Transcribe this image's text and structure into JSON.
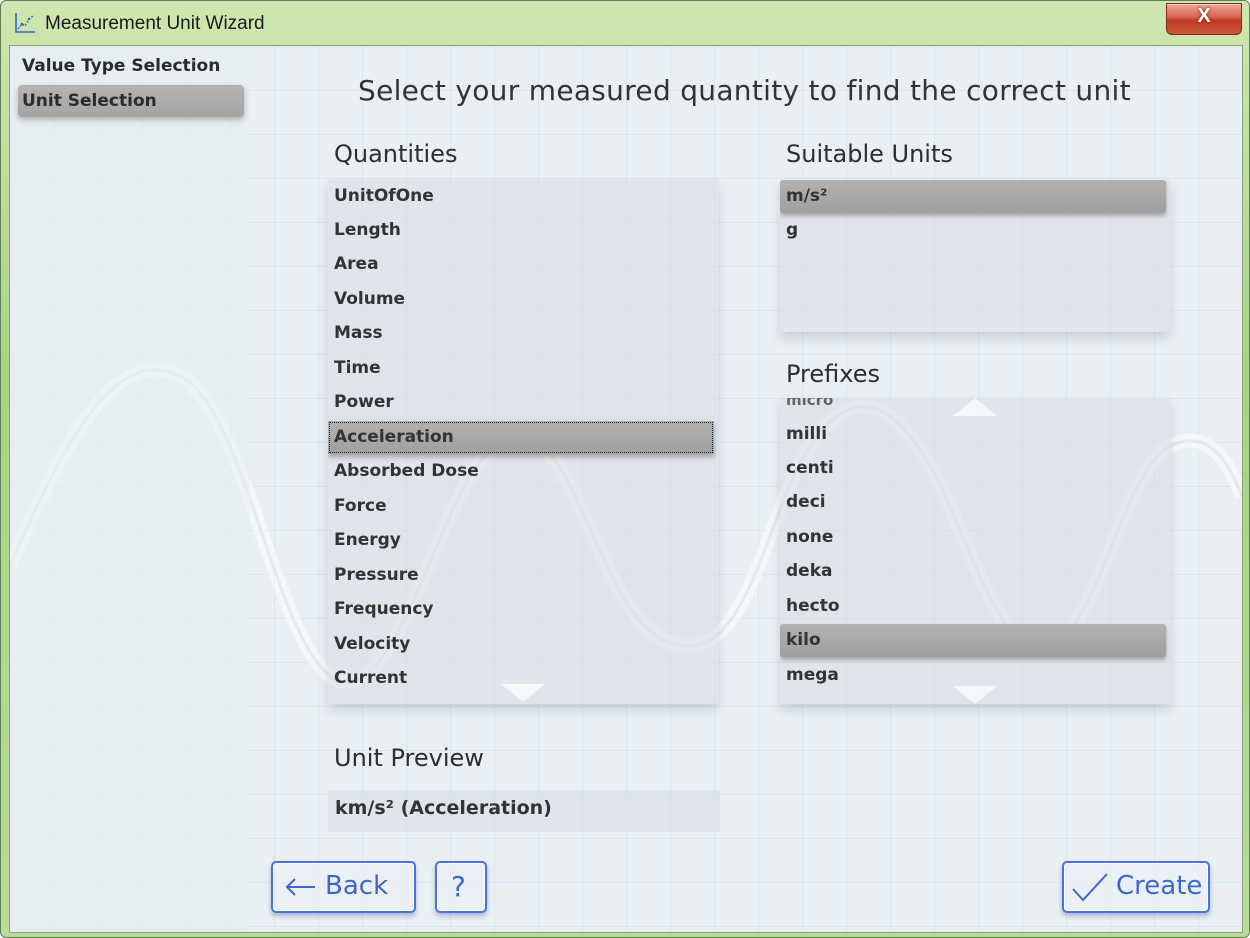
{
  "window": {
    "title": "Measurement Unit Wizard",
    "close_glyph": "X"
  },
  "sidebar": {
    "items": [
      {
        "label": "Value Type Selection",
        "active": false
      },
      {
        "label": "Unit Selection",
        "active": true
      }
    ]
  },
  "main": {
    "heading": "Select your measured quantity to find the correct unit",
    "quantities": {
      "title": "Quantities",
      "items": [
        "UnitOfOne",
        "Length",
        "Area",
        "Volume",
        "Mass",
        "Time",
        "Power",
        "Acceleration",
        "Absorbed Dose",
        "Force",
        "Energy",
        "Pressure",
        "Frequency",
        "Velocity",
        "Current"
      ],
      "selected": "Acceleration"
    },
    "units": {
      "title": "Suitable Units",
      "items": [
        "m/s²",
        "g"
      ],
      "selected": "m/s²"
    },
    "prefixes": {
      "title": "Prefixes",
      "partial_top": "micro",
      "items": [
        "milli",
        "centi",
        "deci",
        "none",
        "deka",
        "hecto",
        "kilo",
        "mega"
      ],
      "selected": "kilo"
    },
    "preview": {
      "title": "Unit Preview",
      "value": "km/s² (Acceleration)"
    }
  },
  "footer": {
    "back_label": "Back",
    "help_label": "?",
    "create_label": "Create"
  },
  "icons": {
    "app": "chart-icon",
    "back": "arrow-left-icon",
    "create": "checkmark-icon"
  },
  "colors": {
    "accent": "#3f66cf",
    "selection": "#a8a8a8",
    "close": "#c9432f"
  }
}
